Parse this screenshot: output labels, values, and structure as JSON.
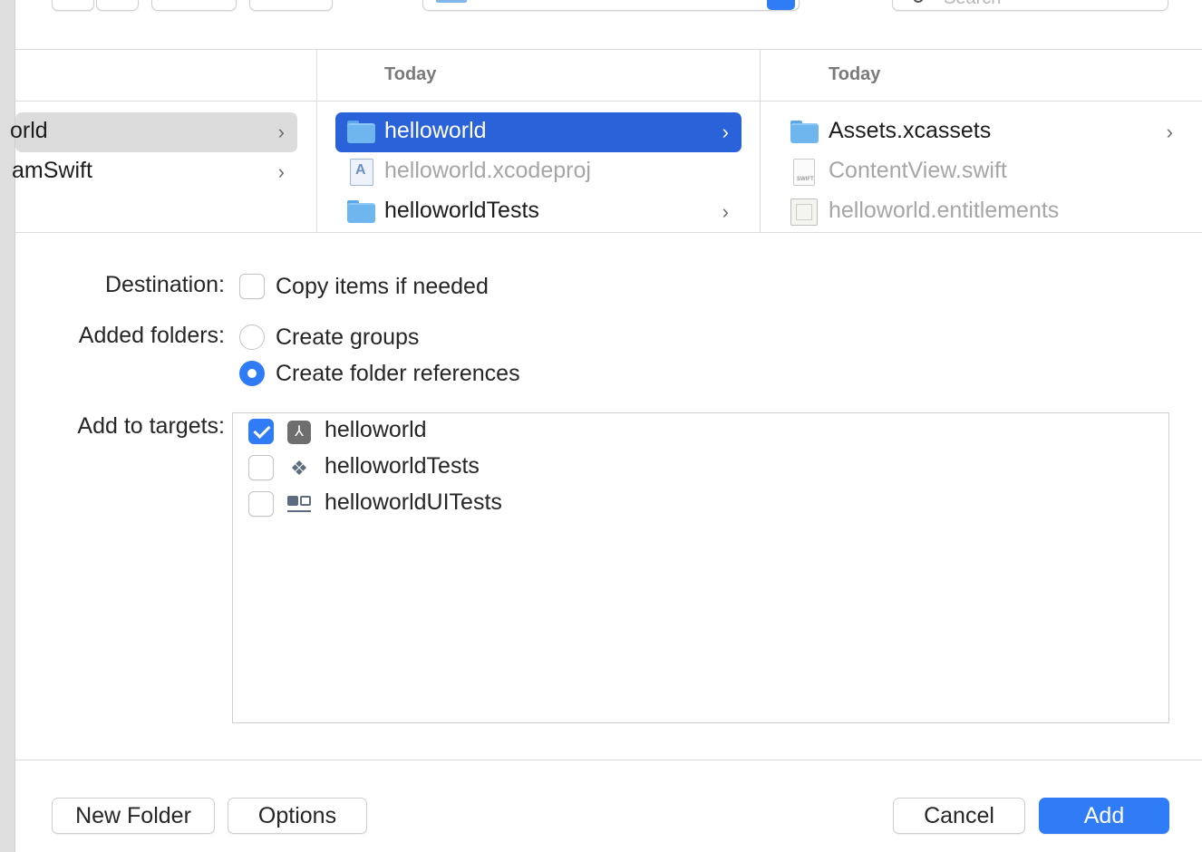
{
  "toolbar": {
    "search_placeholder": "Search"
  },
  "browser": {
    "columns": [
      {
        "header": "",
        "items": [
          {
            "label": "orld",
            "has_children": true,
            "selected": "inactive"
          },
          {
            "label": "amSwift",
            "has_children": true,
            "selected": "none"
          }
        ]
      },
      {
        "header": "Today",
        "items": [
          {
            "label": "helloworld",
            "icon": "folder-icon",
            "has_children": true,
            "selected": "active"
          },
          {
            "label": "helloworld.xcodeproj",
            "icon": "xcodeproj-icon",
            "has_children": false,
            "dimmed": true
          },
          {
            "label": "helloworldTests",
            "icon": "folder-icon",
            "has_children": true
          }
        ]
      },
      {
        "header": "Today",
        "items": [
          {
            "label": "Assets.xcassets",
            "icon": "folder-icon",
            "has_children": true
          },
          {
            "label": "ContentView.swift",
            "icon": "swift-file-icon",
            "has_children": false,
            "dimmed": true
          },
          {
            "label": "helloworld.entitlements",
            "icon": "entitlements-icon",
            "has_children": false,
            "dimmed": true
          }
        ]
      }
    ]
  },
  "options": {
    "destination_label": "Destination:",
    "copy_items_label": "Copy items if needed",
    "copy_items_checked": false,
    "added_folders_label": "Added folders:",
    "create_groups_label": "Create groups",
    "create_folder_refs_label": "Create folder references",
    "added_folders_selected": "Create folder references",
    "add_to_targets_label": "Add to targets:",
    "targets": [
      {
        "name": "helloworld",
        "icon": "app-target-icon",
        "checked": true
      },
      {
        "name": "helloworldTests",
        "icon": "unit-test-target-icon",
        "checked": false
      },
      {
        "name": "helloworldUITests",
        "icon": "ui-test-target-icon",
        "checked": false
      }
    ]
  },
  "buttons": {
    "new_folder": "New Folder",
    "options": "Options",
    "cancel": "Cancel",
    "add": "Add"
  },
  "colors": {
    "accent": "#2f7cf6",
    "selection_active": "#2a62d9",
    "selection_inactive": "#dcdcdc"
  },
  "chevron_glyph": "›"
}
